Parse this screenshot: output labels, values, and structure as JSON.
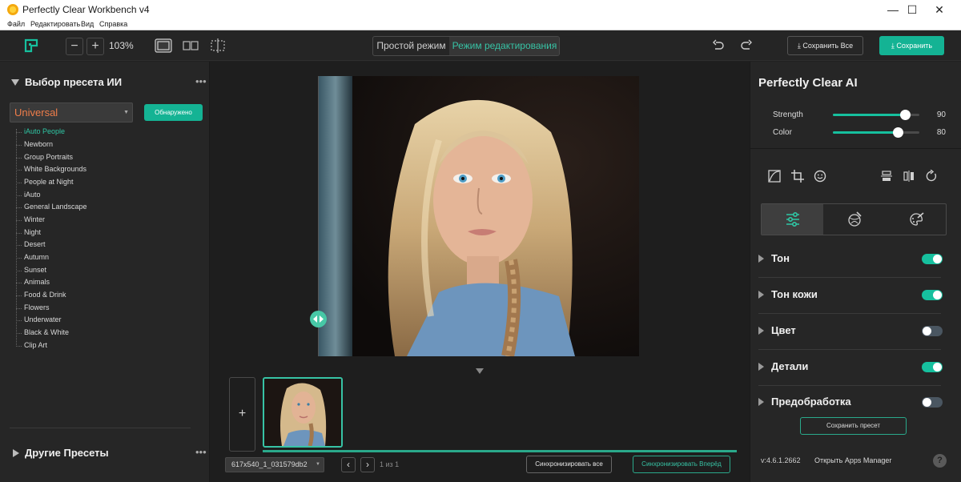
{
  "window": {
    "title": "Perfectly Clear Workbench v4",
    "minimize": "—",
    "maximize": "☐",
    "close": "✕"
  },
  "menu": [
    "Файл",
    "Редактировать",
    "Вид",
    "Справка"
  ],
  "toolbar": {
    "zoom_out": "−",
    "zoom_in": "+",
    "zoom_level": "103%",
    "mode_simple": "Простой режим",
    "mode_edit": "Режим редактирования",
    "save_all": "Сохранить Все",
    "save": "Сохранить",
    "accent_color": "#14b394"
  },
  "left_panel": {
    "ai_preset_title": "Выбор пресета ИИ",
    "preset_select_value": "Universal",
    "detected_button": "Обнаружено",
    "presets": [
      "iAuto People",
      "Newborn",
      "Group Portraits",
      "White Backgrounds",
      "People at Night",
      "iAuto",
      "General Landscape",
      "Winter",
      "Night",
      "Desert",
      "Autumn",
      "Sunset",
      "Animals",
      "Food & Drink",
      "Flowers",
      "Underwater",
      "Black & White",
      "Clip Art"
    ],
    "active_preset": "iAuto People",
    "other_presets_title": "Другие Пресеты",
    "more_menu": "•••"
  },
  "center": {
    "add_image": "+",
    "file_select_value": "617x540_1_031579db2",
    "prev": "‹",
    "next": "›",
    "pager": "1 из 1",
    "sync_all": "Синхронизировать все",
    "sync_forward": "Синхронизировать Вперёд"
  },
  "right_panel": {
    "title": "Perfectly Clear AI",
    "sliders": [
      {
        "label": "Strength",
        "value": 90
      },
      {
        "label": "Color",
        "value": 80
      }
    ],
    "sections": [
      {
        "label": "Тон",
        "enabled": true
      },
      {
        "label": "Тон кожи",
        "enabled": true
      },
      {
        "label": "Цвет",
        "enabled": false
      },
      {
        "label": "Детали",
        "enabled": true
      },
      {
        "label": "Предобработка",
        "enabled": false
      }
    ],
    "save_preset": "Сохранить пресет",
    "version": "v:4.6.1.2662",
    "apps_manager": "Открыть Apps Manager",
    "help": "?"
  }
}
